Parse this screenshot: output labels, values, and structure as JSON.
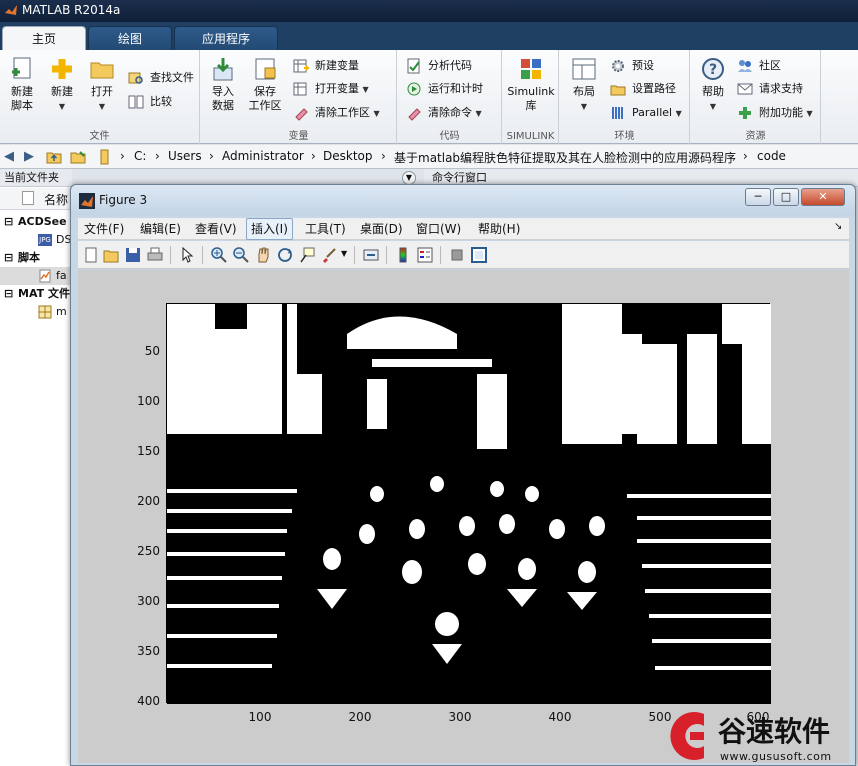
{
  "app": {
    "title": "MATLAB R2014a"
  },
  "tabs": [
    {
      "label": "主页",
      "active": true
    },
    {
      "label": "绘图",
      "active": false
    },
    {
      "label": "应用程序",
      "active": false
    }
  ],
  "ribbon": {
    "file_group": {
      "label": "文件",
      "new_script": "新建\n脚本",
      "new": "新建",
      "open": "打开",
      "find_files": "查找文件",
      "compare": "比较"
    },
    "variable_group": {
      "label": "变量",
      "import_data": "导入\n数据",
      "save_workspace": "保存\n工作区",
      "new_variable": "新建变量",
      "open_variable": "打开变量",
      "clear_workspace": "清除工作区"
    },
    "code_group": {
      "label": "代码",
      "analyze_code": "分析代码",
      "run_and_time": "运行和计时",
      "clear_commands": "清除命令"
    },
    "simulink_group": {
      "label": "SIMULINK",
      "simulink_library": "Simulink\n库"
    },
    "environment_group": {
      "label": "环境",
      "layout": "布局",
      "preferences": "预设",
      "set_path": "设置路径",
      "parallel": "Parallel"
    },
    "resources_group": {
      "label": "资源",
      "help": "帮助",
      "community": "社区",
      "request_support": "请求支持",
      "add_ons": "附加功能"
    }
  },
  "address": {
    "segments": [
      "C:",
      "Users",
      "Administrator",
      "Desktop",
      "基于matlab编程肤色特征提取及其在人脸检测中的应用源码程序",
      "code"
    ]
  },
  "left_panel": {
    "title": "当前文件夹",
    "column_name": "名称",
    "rows": [
      {
        "label": "ACDSee",
        "kind": "group"
      },
      {
        "label": "DS",
        "kind": "file"
      },
      {
        "label": "脚本",
        "kind": "group"
      },
      {
        "label": "fa",
        "kind": "file"
      },
      {
        "label": "MAT 文件",
        "kind": "group"
      },
      {
        "label": "m",
        "kind": "file"
      }
    ]
  },
  "command_window": {
    "title": "命令行窗口"
  },
  "figure": {
    "title": "Figure 3",
    "menu": [
      "文件(F)",
      "编辑(E)",
      "查看(V)",
      "插入(I)",
      "工具(T)",
      "桌面(D)",
      "窗口(W)",
      "帮助(H)"
    ],
    "active_menu_index": 3,
    "window_buttons": {
      "minimize": "─",
      "maximize": "□",
      "close": "✕"
    },
    "axes": {
      "y_ticks": [
        "50",
        "100",
        "150",
        "200",
        "250",
        "300",
        "350",
        "400"
      ],
      "x_ticks": [
        "100",
        "200",
        "300",
        "400",
        "500",
        "600"
      ],
      "xlim": [
        0,
        600
      ],
      "ylim": [
        0,
        400
      ]
    }
  },
  "watermark": {
    "text": "谷速软件",
    "url": "www.gususoft.com"
  }
}
